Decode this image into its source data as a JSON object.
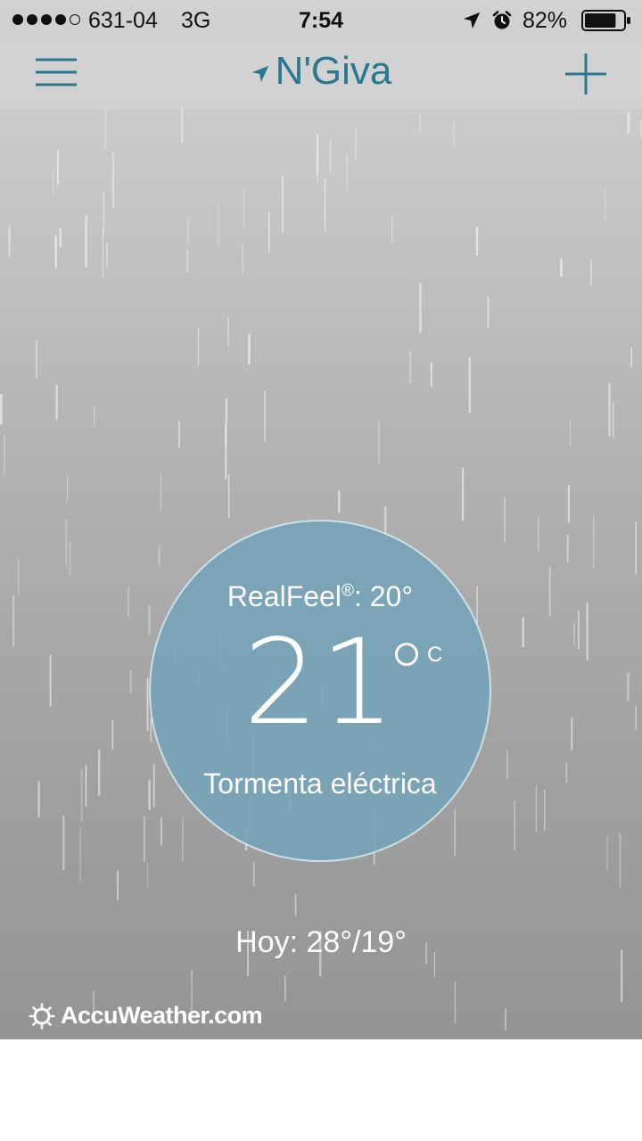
{
  "status_bar": {
    "carrier": "631-04",
    "network": "3G",
    "time": "7:54",
    "battery_percent": "82%",
    "signal_bars_filled": 4,
    "signal_bars_total": 5,
    "battery_level": 0.82,
    "icons": [
      "location-arrow-icon",
      "alarm-icon",
      "battery-icon"
    ]
  },
  "nav": {
    "city": "N'Giva",
    "icons": [
      "hamburger-menu-icon",
      "location-arrow-icon",
      "plus-icon"
    ],
    "accent_color": "#2a7890"
  },
  "weather": {
    "realfeel_label": "RealFeel",
    "realfeel_mark": "®",
    "realfeel_value": ": 20°",
    "temperature": "21",
    "unit": "C",
    "condition": "Tormenta eléctrica",
    "today": "Hoy: 28°/19°",
    "circle_color": "#75a3b8"
  },
  "footer": {
    "brand": "AccuWeather.com",
    "icon": "sun-icon"
  }
}
